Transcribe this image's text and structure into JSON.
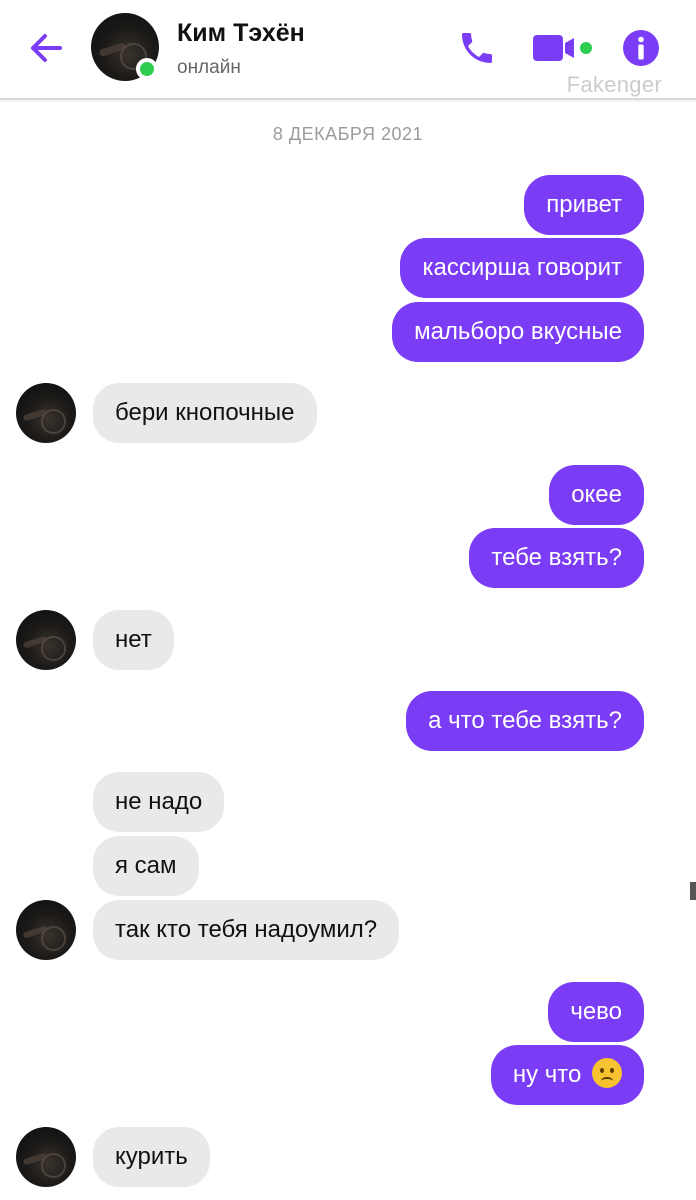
{
  "header": {
    "contact_name": "Ким Тэхён",
    "status": "онлайн",
    "watermark": "Fakenger"
  },
  "colors": {
    "accent": "#7a3cf5",
    "incoming_bubble": "#e9e9eb",
    "online": "#2ecc4f"
  },
  "icons": [
    "arrow-left-icon",
    "phone-icon",
    "video-camera-icon",
    "info-icon"
  ],
  "chat": {
    "date": "8 ДЕКАБРЯ 2021",
    "messages": [
      {
        "dir": "out",
        "text": "привет"
      },
      {
        "dir": "out",
        "text": "кассирша говорит"
      },
      {
        "dir": "out",
        "text": "мальборо вкусные"
      },
      {
        "dir": "in",
        "text": "бери кнопочные"
      },
      {
        "dir": "out",
        "text": "окее"
      },
      {
        "dir": "out",
        "text": "тебе взять?"
      },
      {
        "dir": "in",
        "text": "нет"
      },
      {
        "dir": "out",
        "text": "а что тебе взять?"
      },
      {
        "dir": "in",
        "text": "не надо"
      },
      {
        "dir": "in",
        "text": "я сам"
      },
      {
        "dir": "in",
        "text": "так кто тебя надоумил?"
      },
      {
        "dir": "out",
        "text": "чево"
      },
      {
        "dir": "out",
        "text": "ну что",
        "emoji": "frowning-face-emoji"
      },
      {
        "dir": "in",
        "text": "курить"
      }
    ]
  }
}
